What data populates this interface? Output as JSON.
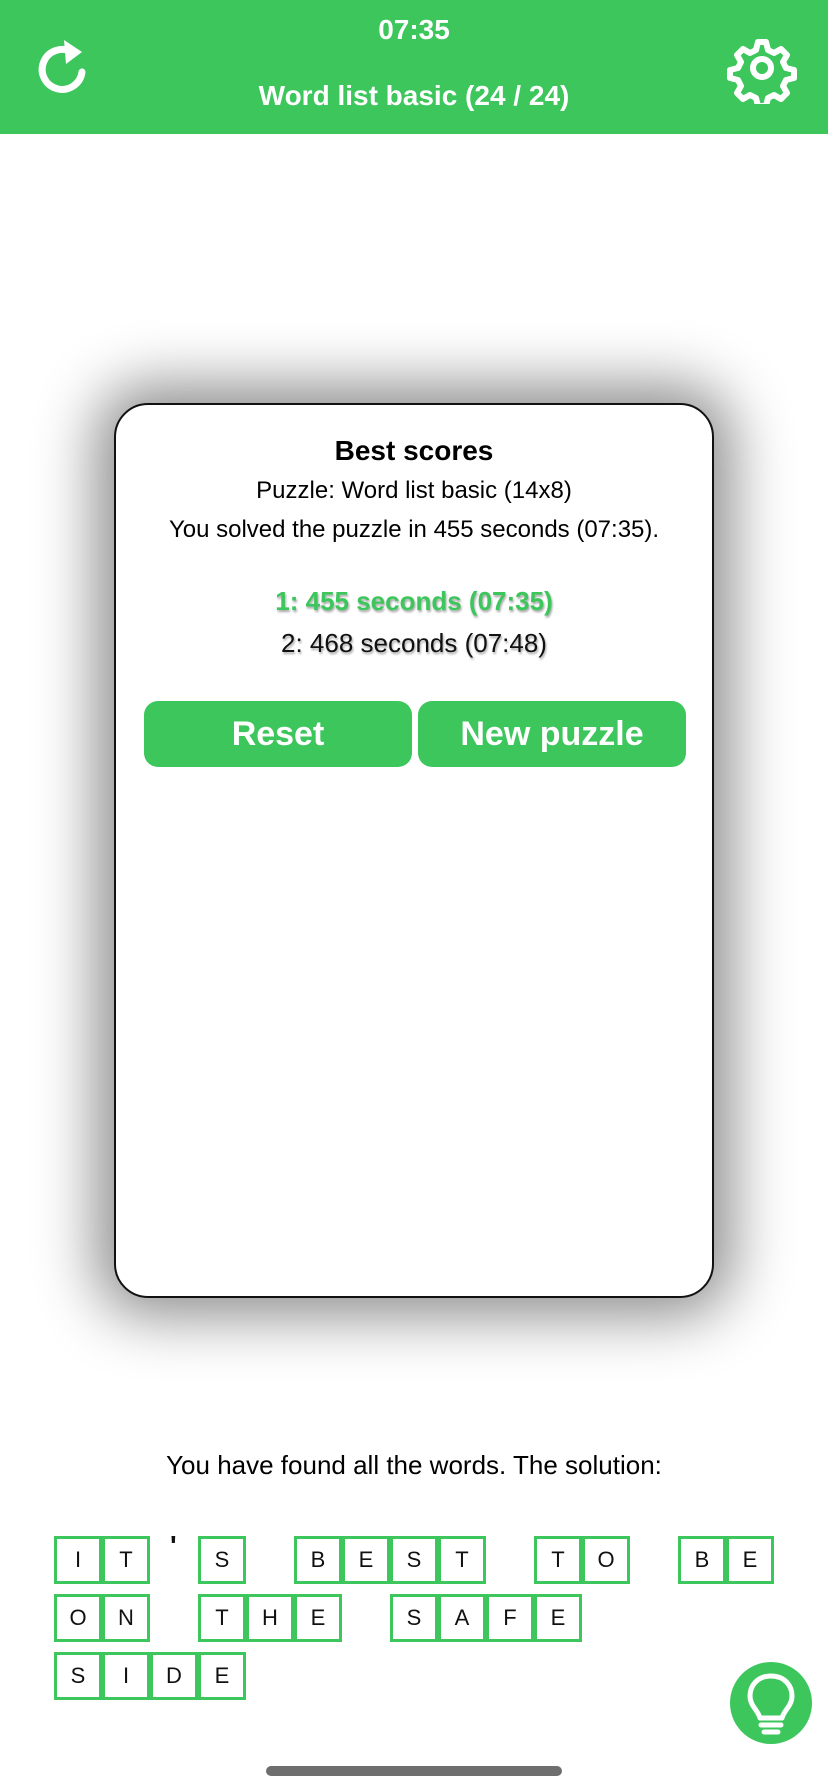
{
  "header": {
    "timer": "07:35",
    "title": "Word list basic (24 / 24)",
    "refresh_icon": "refresh-icon",
    "settings_icon": "gear-icon",
    "color": "#3cc65c"
  },
  "modal": {
    "title": "Best scores",
    "puzzle": "Puzzle: Word list basic (14x8)",
    "solved": "You solved the puzzle in 455 seconds (07:35).",
    "scores": [
      "1: 455 seconds (07:35)",
      "2: 468 seconds (07:48)"
    ],
    "reset_label": "Reset",
    "new_puzzle_label": "New puzzle"
  },
  "solution": {
    "label": "You have found all the words. The solution:",
    "rows": [
      [
        "I",
        "T",
        "'",
        "S",
        "B",
        "E",
        "S",
        "T",
        "T",
        "O",
        "B",
        "E"
      ],
      [
        "O",
        "N",
        "T",
        "H",
        "E",
        "S",
        "A",
        "F",
        "E"
      ],
      [
        "S",
        "I",
        "D",
        "E"
      ]
    ]
  },
  "hint_icon": "lightbulb-icon"
}
